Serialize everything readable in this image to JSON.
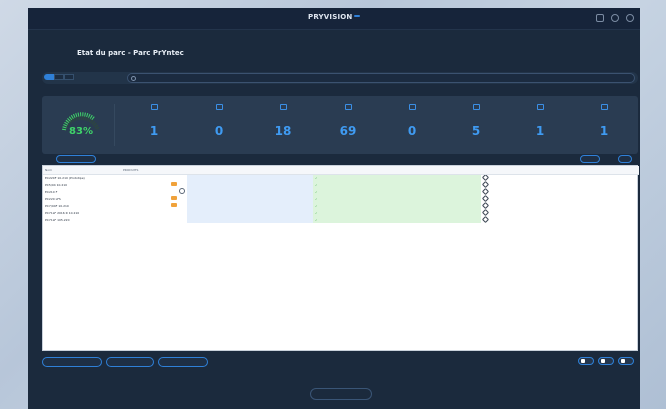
{
  "app": {
    "brand": "PRYVISION",
    "brand_badge": "",
    "brand_sub": "",
    "user_line1": "",
    "user_line2": ""
  },
  "page": {
    "title": "Etat du parc - Parc PrYntec"
  },
  "filter": {
    "tabs": [
      "",
      "",
      ""
    ],
    "search_text": ""
  },
  "stats": {
    "gauge_value": "83%",
    "items": [
      {
        "label": "",
        "value": "1"
      },
      {
        "label": "",
        "value": "0"
      },
      {
        "label": "",
        "value": "18"
      },
      {
        "label": "",
        "value": "69"
      },
      {
        "label": "",
        "value": "0"
      },
      {
        "label": "",
        "value": "5"
      },
      {
        "label": "",
        "value": "1"
      },
      {
        "label": "",
        "value": "1"
      }
    ]
  },
  "toolbar": {
    "left_button": "",
    "right_link": "",
    "right_button": "",
    "right_small": ""
  },
  "table": {
    "headers": [
      "Nom",
      "PRODUITS",
      "",
      "",
      "",
      "",
      "",
      "",
      "",
      "",
      ""
    ],
    "rows": [
      {
        "name": "EC220F 10.210 (Prototipe)",
        "c1": "",
        "c2": "",
        "c3": "",
        "c4": "",
        "c5": "",
        "c6": "",
        "c7": "",
        "c8": "",
        "c9": "",
        "c10": ""
      },
      {
        "name": "PC5/04 10.210",
        "c1": "",
        "c2": "",
        "c3": "",
        "c4": "",
        "c5": "",
        "c6": "",
        "c7": "",
        "c8": "",
        "c9": "",
        "c10": ""
      },
      {
        "name": "EC210 F",
        "c1": "",
        "c2": "",
        "c3": "",
        "c4": "",
        "c5": "",
        "c6": "",
        "c7": "",
        "c8": "",
        "c9": "",
        "c10": ""
      },
      {
        "name": "PC220 LFS",
        "c1": "",
        "c2": "",
        "c3": "",
        "c4": "",
        "c5": "",
        "c6": "",
        "c7": "",
        "c8": "",
        "c9": "",
        "c10": ""
      },
      {
        "name": "PC7/04F 10.210",
        "c1": "",
        "c2": "",
        "c3": "",
        "c4": "",
        "c5": "",
        "c6": "",
        "c7": "",
        "c8": "",
        "c9": "",
        "c10": ""
      },
      {
        "name": "PC71LF 2016 R 10.210",
        "c1": "",
        "c2": "",
        "c3": "",
        "c4": "",
        "c5": "",
        "c6": "",
        "c7": "",
        "c8": "",
        "c9": "",
        "c10": ""
      },
      {
        "name": "PC71LF 105.220",
        "c1": "",
        "c2": "",
        "c3": "",
        "c4": "",
        "c5": "",
        "c6": "",
        "c7": "",
        "c8": "",
        "c9": "",
        "c10": ""
      }
    ]
  },
  "bottom": {
    "btn_left": "",
    "btn_mid": "",
    "btn_right": "",
    "back": ""
  }
}
